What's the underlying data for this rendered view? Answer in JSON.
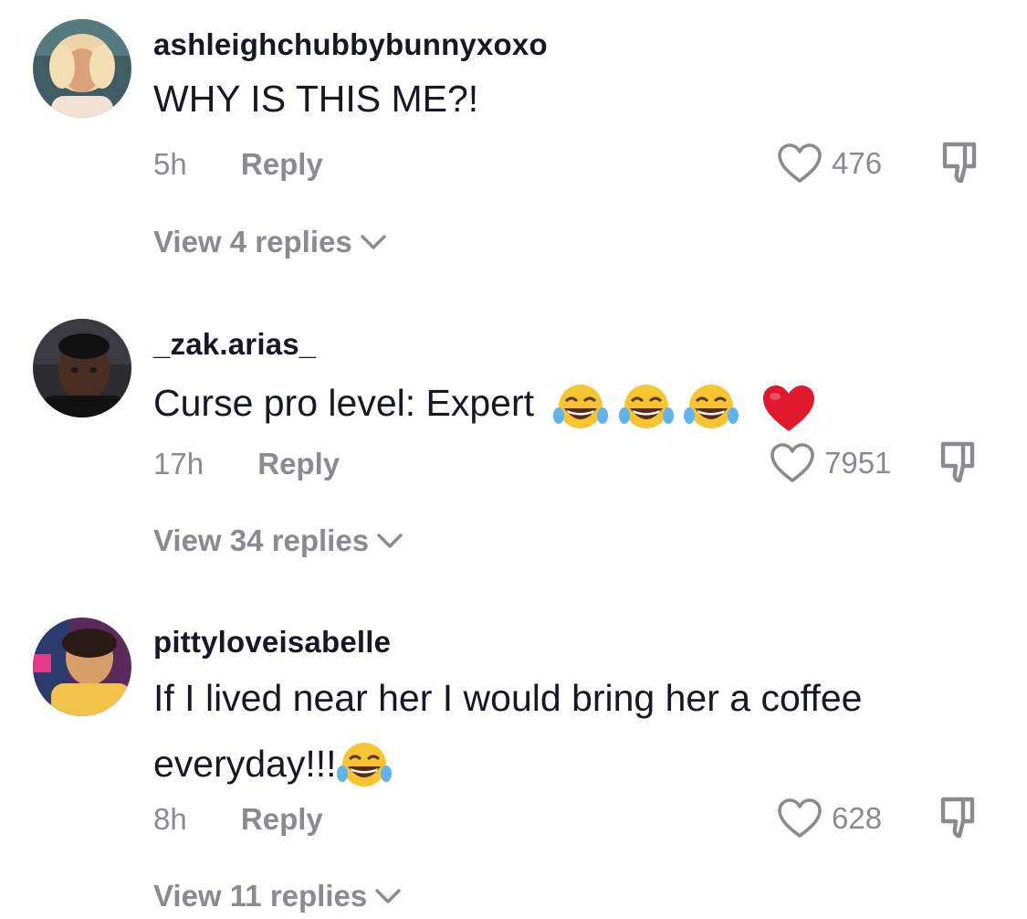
{
  "comments": [
    {
      "username": "ashleighchubbybunnyxoxo",
      "text": "WHY IS THIS ME?!",
      "time": "5h",
      "reply_label": "Reply",
      "likes": "476",
      "view_replies": "View 4 replies",
      "avatar_colors": [
        "#4d6e72",
        "#e8c9a3",
        "#f3d9b0"
      ]
    },
    {
      "username": "_zak.arias_",
      "text": "Curse pro level: Expert",
      "emojis": [
        "😂",
        "😂",
        "😂",
        "❤️"
      ],
      "time": "17h",
      "reply_label": "Reply",
      "likes": "7951",
      "view_replies": "View 34 replies",
      "avatar_colors": [
        "#2a2a2e",
        "#5a3a2a",
        "#141414"
      ]
    },
    {
      "username": "pittyloveisabelle",
      "text_line1": "If I lived near her I would bring her a coffee",
      "text_line2": "everyday!!!",
      "emojis": [
        "😂"
      ],
      "time": "8h",
      "reply_label": "Reply",
      "likes": "628",
      "view_replies": "View 11 replies",
      "avatar_colors": [
        "#6a2a5a",
        "#e3b070",
        "#f2c24a"
      ]
    }
  ],
  "icons": {
    "like": "heart-outline-icon",
    "dislike": "thumbs-down-icon",
    "expand": "chevron-down-icon",
    "emoji_laugh": "face-with-tears-of-joy-icon",
    "emoji_heart": "red-heart-icon"
  },
  "colors": {
    "text_primary": "#161823",
    "text_secondary": "#8a8b91",
    "heart_red": "#e0182c",
    "emoji_yellow": "#f7c532"
  }
}
